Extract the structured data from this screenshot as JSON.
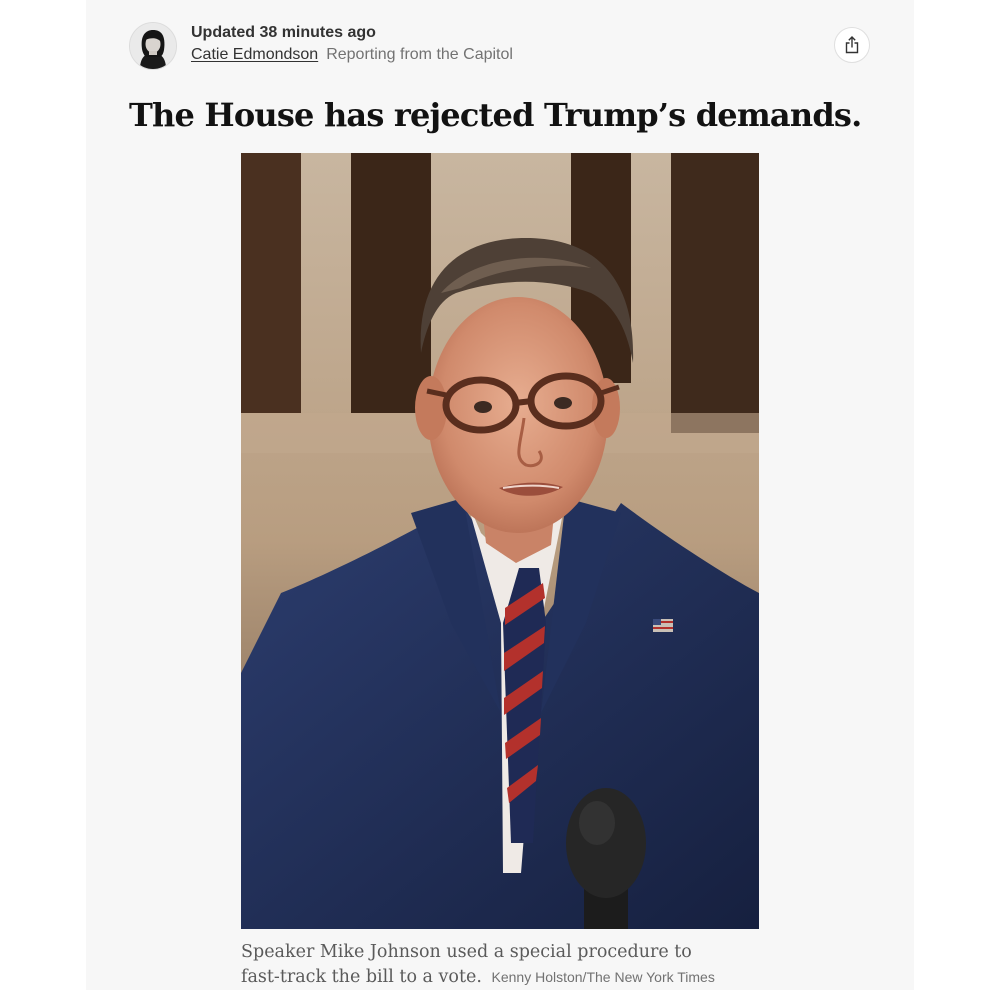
{
  "byline": {
    "updated": "Updated 38 minutes ago",
    "author": "Catie Edmondson",
    "location": "Reporting from the Capitol"
  },
  "share": {
    "icon": "share-icon",
    "aria_label": "Share"
  },
  "headline": "The House has rejected Trump’s demands.",
  "photo": {
    "alt": "Speaker Mike Johnson speaking at a microphone"
  },
  "caption": {
    "text": "Speaker Mike Johnson used a special procedure to fast-track the bill to a vote.",
    "credit": "Kenny Holston/The New York Times"
  }
}
